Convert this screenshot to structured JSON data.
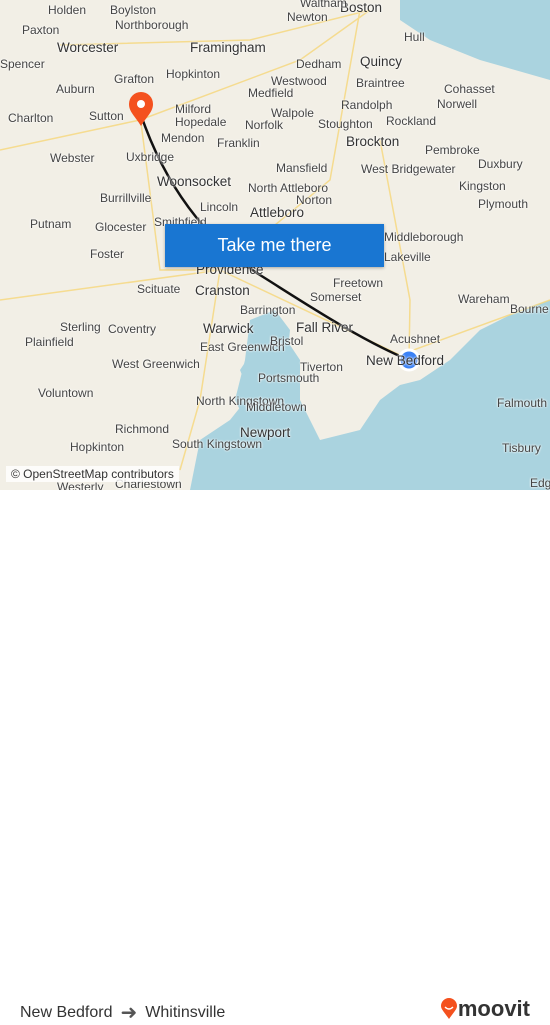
{
  "map": {
    "places": [
      "Boston",
      "Newton",
      "Waltham",
      "Holden",
      "Boylston",
      "Northborough",
      "Paxton",
      "Worcester",
      "Framingham",
      "Quincy",
      "Hull",
      "Dedham",
      "Braintree",
      "Spencer",
      "Grafton",
      "Hopkinton",
      "Westwood",
      "Auburn",
      "Milford",
      "Medfield",
      "Randolph",
      "Cohasset",
      "Charlton",
      "Sutton",
      "Hopedale",
      "Walpole",
      "Stoughton",
      "Rockland",
      "Norwell",
      "Norfolk",
      "Mendon",
      "Uxbridge",
      "Webster",
      "Franklin",
      "Brockton",
      "Pembroke",
      "Mansfield",
      "Duxbury",
      "Woonsocket",
      "North Attleboro",
      "West Bridgewater",
      "Kingston",
      "Burrillville",
      "Norton",
      "Plymouth",
      "Attleboro",
      "Lincoln",
      "Putnam",
      "Glocester",
      "Smithfield",
      "Middleborough",
      "Foster",
      "Providence",
      "Lakeville",
      "Freetown",
      "Scituate",
      "Cranston",
      "Somerset",
      "Wareham",
      "Barrington",
      "Fall River",
      "Bourne",
      "Sterling",
      "Coventry",
      "Warwick",
      "Acushnet",
      "Plainfield",
      "East Greenwich",
      "Bristol",
      "New Bedford",
      "West Greenwich",
      "Tiverton",
      "Portsmouth",
      "Voluntown",
      "North Kingstown",
      "Falmouth",
      "Middletown",
      "Richmond",
      "Newport",
      "Hopkinton",
      "South Kingstown",
      "Tisbury",
      "Westerly",
      "Charlestown",
      "Edg"
    ],
    "origin_dot_color": "#3b82f6",
    "destination_pin_color": "#f4511e",
    "route_color": "#111111"
  },
  "cta": {
    "label": "Take me there"
  },
  "attribution": "© OpenStreetMap contributors",
  "footer": {
    "origin": "New Bedford",
    "destination": "Whitinsville",
    "brand": "moovit",
    "brand_color": "#f4511e"
  }
}
